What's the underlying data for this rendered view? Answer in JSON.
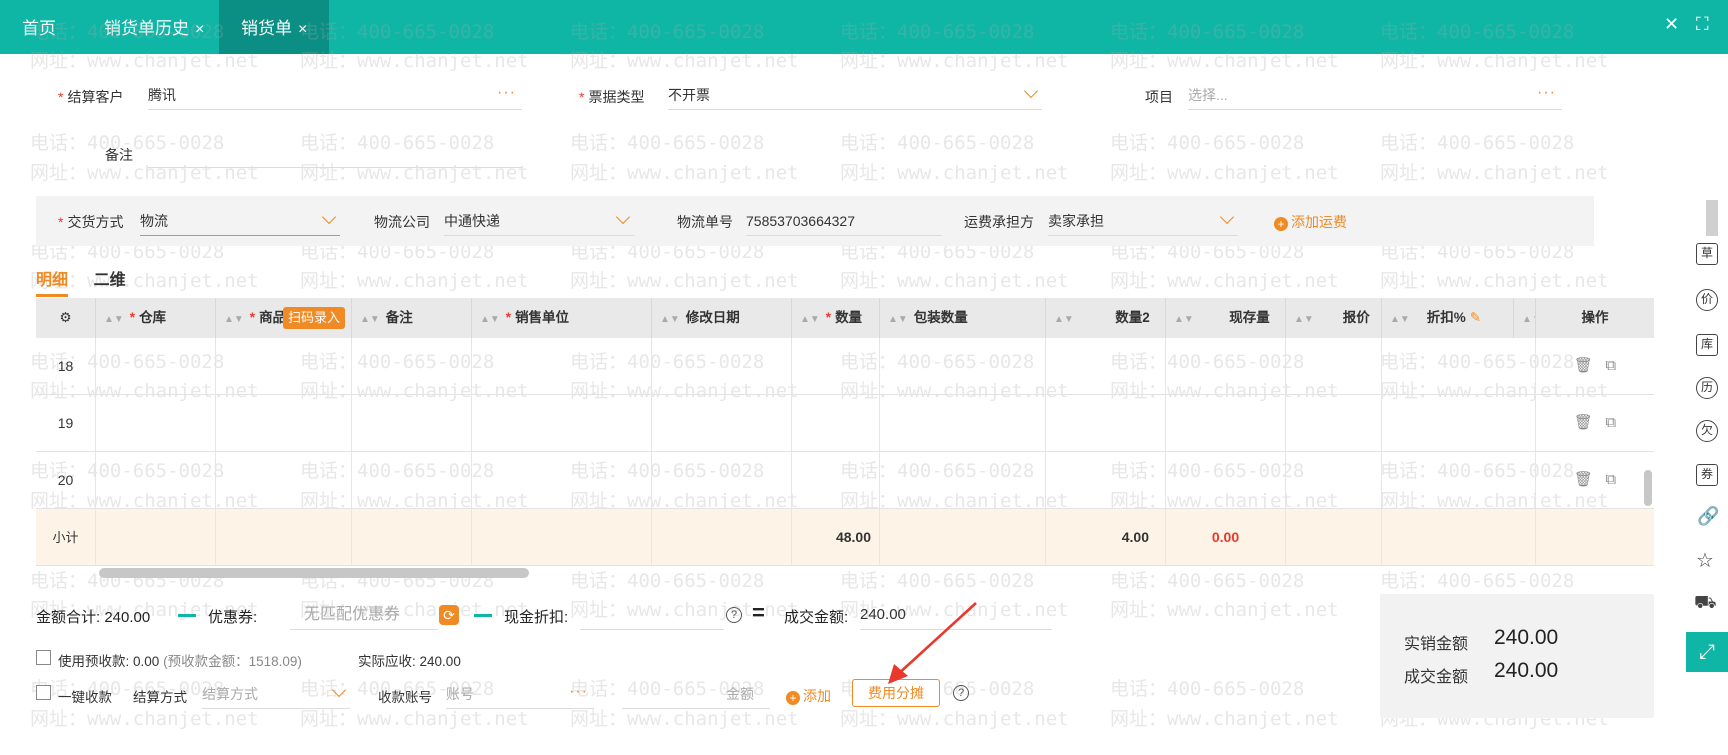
{
  "tabs": [
    {
      "label": "首页",
      "closable": false,
      "active": false
    },
    {
      "label": "销货单历史",
      "closable": true,
      "active": false
    },
    {
      "label": "销货单",
      "closable": true,
      "active": true
    }
  ],
  "window": {
    "close": "✕",
    "expand": "⛶"
  },
  "watermark": {
    "phone": "电话：400-665-0028",
    "site": "网址：www.chanjet.net"
  },
  "form": {
    "customer": {
      "label": "结算客户",
      "value": "腾讯",
      "required": true
    },
    "invoice_type": {
      "label": "票据类型",
      "value": "不开票",
      "required": true
    },
    "project": {
      "label": "项目",
      "placeholder": "选择..."
    },
    "remark": {
      "label": "备注",
      "value": ""
    }
  },
  "shipping": {
    "delivery_method": {
      "label": "交货方式",
      "value": "物流",
      "required": true
    },
    "logistics_company": {
      "label": "物流公司",
      "value": "中通快递"
    },
    "tracking_no": {
      "label": "物流单号",
      "value": "75853703664327"
    },
    "freight_payer": {
      "label": "运费承担方",
      "value": "卖家承担"
    },
    "add_freight": "添加运费"
  },
  "subtabs": [
    {
      "label": "明细",
      "active": true
    },
    {
      "label": "二维",
      "active": false
    }
  ],
  "table": {
    "columns": [
      "仓库",
      "商品",
      "备注",
      "销售单位",
      "修改日期",
      "数量",
      "包装数量",
      "数量2",
      "现存量",
      "报价",
      "折扣%",
      "操作"
    ],
    "scan_badge": "扫码录入",
    "rows": [
      {
        "no": "18"
      },
      {
        "no": "19"
      },
      {
        "no": "20"
      }
    ],
    "subtotal": {
      "label": "小计",
      "qty": "48.00",
      "qty2": "4.00",
      "amount": "0.00"
    }
  },
  "totals": {
    "amount_total_label": "金额合计:",
    "amount_total": "240.00",
    "coupon_label": "优惠券:",
    "coupon_placeholder": "无匹配优惠券",
    "cash_discount_label": "现金折扣:",
    "deal_amount_label": "成交金额:",
    "deal_amount": "240.00",
    "use_prepaid_label": "使用预收款:",
    "use_prepaid_value": "0.00",
    "prepaid_note": "(预收款金额：1518.09)",
    "actual_receivable_label": "实际应收:",
    "actual_receivable": "240.00",
    "one_click_label": "一键收款",
    "settle_method_label": "结算方式",
    "settle_method_placeholder": "结算方式",
    "account_label": "收款账号",
    "account_placeholder": "账号",
    "amount_placeholder": "金额",
    "add_label": "添加",
    "fee_split_label": "费用分摊"
  },
  "summary": {
    "actual_sales_label": "实销金额",
    "actual_sales": "240.00",
    "deal_label": "成交金额",
    "deal": "240.00"
  },
  "rail": [
    "草",
    "价",
    "库",
    "历",
    "欠",
    "券"
  ]
}
